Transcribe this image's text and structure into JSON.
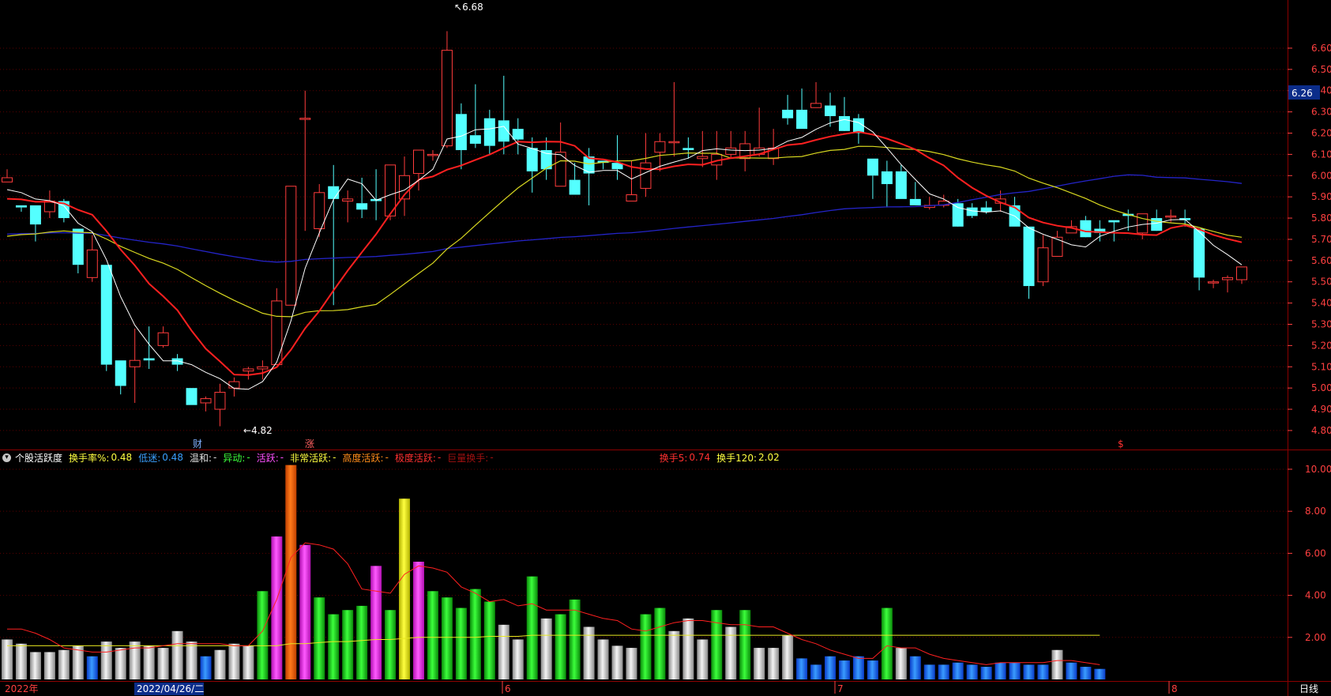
{
  "indicator_bar": {
    "name": "个股活跃度",
    "turnover_label": "换手率%:",
    "turnover_value": "0.48",
    "low_label": "低迷:",
    "low_value": "0.48",
    "mild_label": "温和:",
    "mild_value": "-",
    "abnormal_label": "异动:",
    "abnormal_value": "-",
    "active_label": "活跃:",
    "active_value": "-",
    "very_active_label": "非常活跃:",
    "very_active_value": "-",
    "high_active_label": "高度活跃:",
    "high_active_value": "-",
    "extreme_label": "极度活跃:",
    "extreme_value": "-",
    "huge_label": "巨量换手:",
    "huge_value": "-",
    "hs5_label": "换手5:",
    "hs5_value": "0.74",
    "hs120_label": "换手120:",
    "hs120_value": "2.02"
  },
  "bottom_axis": {
    "year": "2022年",
    "cursor_date": "2022/04/26/二",
    "months": [
      "6",
      "7",
      "8"
    ],
    "period": "日线"
  },
  "markers": {
    "high": "6.68",
    "low": "4.82",
    "cai": "财",
    "zhang": "涨",
    "dollar": "$"
  },
  "colors": {
    "up": "#ff3c3c",
    "down": "#54ffff",
    "ma5": "#ffffff",
    "ma10": "#ff2020",
    "ma20": "#d8d820",
    "ma60": "#2424c8",
    "current_price_box": "#0b2d8a"
  },
  "chart_data": [
    {
      "type": "candlestick",
      "y_ticks": [
        "6.60",
        "6.50",
        "6.40",
        "6.30",
        "6.20",
        "6.10",
        "6.00",
        "5.90",
        "5.80",
        "5.70",
        "5.60",
        "5.50",
        "5.40",
        "5.30",
        "5.20",
        "5.10",
        "5.00",
        "4.90",
        "4.80"
      ],
      "ylim": [
        4.77,
        6.73
      ],
      "current_price": "6.26",
      "ohlc": [
        [
          5.97,
          5.99,
          5.98,
          6.03
        ],
        [
          5.86,
          5.85,
          5.83,
          5.86
        ],
        [
          5.86,
          5.77,
          5.69,
          5.86
        ],
        [
          5.83,
          5.88,
          5.8,
          5.93
        ],
        [
          5.88,
          5.8,
          5.78,
          5.89
        ],
        [
          5.75,
          5.58,
          5.54,
          5.75
        ],
        [
          5.52,
          5.65,
          5.5,
          5.72
        ],
        [
          5.58,
          5.11,
          5.08,
          5.58
        ],
        [
          5.13,
          5.01,
          4.97,
          5.13
        ],
        [
          5.1,
          5.13,
          4.93,
          5.28
        ],
        [
          5.14,
          5.13,
          5.09,
          5.29
        ],
        [
          5.2,
          5.26,
          5.19,
          5.29
        ],
        [
          5.14,
          5.11,
          5.08,
          5.16
        ],
        [
          5.0,
          4.92,
          4.92,
          5.0
        ],
        [
          4.93,
          4.95,
          4.89,
          4.96
        ],
        [
          4.9,
          4.98,
          4.82,
          5.02
        ],
        [
          5.0,
          5.03,
          4.96,
          5.05
        ],
        [
          5.08,
          5.09,
          5.04,
          5.1
        ],
        [
          5.09,
          5.1,
          5.04,
          5.13
        ],
        [
          5.11,
          5.41,
          5.11,
          5.47
        ],
        [
          5.39,
          5.95,
          5.39,
          5.95
        ],
        [
          6.27,
          6.27,
          5.74,
          6.4
        ],
        [
          5.75,
          5.92,
          5.71,
          5.96
        ],
        [
          5.95,
          5.89,
          5.39,
          6.05
        ],
        [
          5.88,
          5.89,
          5.78,
          5.93
        ],
        [
          5.87,
          5.84,
          5.8,
          5.99
        ],
        [
          5.89,
          5.88,
          5.79,
          6.03
        ],
        [
          5.81,
          6.05,
          5.79,
          6.05
        ],
        [
          5.89,
          6.0,
          5.81,
          6.09
        ],
        [
          6.01,
          6.12,
          5.93,
          6.12
        ],
        [
          6.1,
          6.1,
          6.07,
          6.12
        ],
        [
          6.14,
          6.59,
          6.13,
          6.68
        ],
        [
          6.29,
          6.12,
          6.03,
          6.34
        ],
        [
          6.19,
          6.15,
          6.13,
          6.43
        ],
        [
          6.27,
          6.14,
          6.1,
          6.31
        ],
        [
          6.26,
          6.16,
          6.1,
          6.47
        ],
        [
          6.22,
          6.17,
          6.1,
          6.27
        ],
        [
          6.13,
          6.02,
          5.92,
          6.18
        ],
        [
          6.12,
          6.03,
          5.98,
          6.18
        ],
        [
          5.95,
          6.11,
          6.05,
          6.25
        ],
        [
          5.98,
          5.91,
          5.91,
          6.06
        ],
        [
          6.09,
          6.01,
          5.86,
          6.13
        ],
        [
          6.07,
          6.06,
          6.03,
          6.07
        ],
        [
          6.06,
          6.03,
          5.98,
          6.19
        ],
        [
          5.88,
          5.91,
          5.96,
          6.07
        ],
        [
          5.94,
          6.06,
          5.9,
          6.2
        ],
        [
          6.11,
          6.16,
          6.02,
          6.2
        ],
        [
          6.16,
          6.16,
          6.09,
          6.44
        ],
        [
          6.13,
          6.12,
          6.08,
          6.18
        ],
        [
          6.08,
          6.09,
          6.04,
          6.21
        ],
        [
          6.05,
          6.1,
          5.98,
          6.21
        ],
        [
          6.1,
          6.13,
          6.08,
          6.21
        ],
        [
          6.08,
          6.15,
          6.02,
          6.21
        ],
        [
          6.1,
          6.13,
          6.09,
          6.32
        ],
        [
          6.08,
          6.13,
          6.05,
          6.22
        ],
        [
          6.31,
          6.27,
          6.24,
          6.38
        ],
        [
          6.31,
          6.22,
          6.22,
          6.41
        ],
        [
          6.32,
          6.34,
          6.32,
          6.44
        ],
        [
          6.33,
          6.28,
          6.23,
          6.39
        ],
        [
          6.28,
          6.21,
          6.23,
          6.37
        ],
        [
          6.27,
          6.2,
          6.15,
          6.29
        ],
        [
          6.08,
          6.0,
          5.89,
          6.08
        ],
        [
          6.02,
          5.96,
          5.85,
          6.07
        ],
        [
          6.02,
          5.89,
          5.89,
          6.05
        ],
        [
          5.89,
          5.86,
          5.87,
          5.97
        ],
        [
          5.85,
          5.86,
          5.84,
          5.9
        ],
        [
          5.86,
          5.88,
          5.85,
          5.91
        ],
        [
          5.87,
          5.76,
          5.86,
          5.89
        ],
        [
          5.85,
          5.81,
          5.8,
          5.87
        ],
        [
          5.85,
          5.83,
          5.82,
          5.88
        ],
        [
          5.87,
          5.89,
          5.83,
          5.93
        ],
        [
          5.86,
          5.76,
          5.76,
          5.9
        ],
        [
          5.76,
          5.48,
          5.42,
          5.76
        ],
        [
          5.5,
          5.66,
          5.48,
          5.72
        ],
        [
          5.62,
          5.71,
          5.65,
          5.74
        ],
        [
          5.73,
          5.76,
          5.74,
          5.79
        ],
        [
          5.79,
          5.71,
          5.75,
          5.81
        ],
        [
          5.75,
          5.73,
          5.69,
          5.79
        ],
        [
          5.79,
          5.78,
          5.69,
          5.79
        ],
        [
          5.82,
          5.81,
          5.74,
          5.84
        ],
        [
          5.73,
          5.82,
          5.7,
          5.81
        ],
        [
          5.8,
          5.74,
          5.78,
          5.84
        ],
        [
          5.81,
          5.81,
          5.78,
          5.84
        ],
        [
          5.8,
          5.79,
          5.76,
          5.84
        ],
        [
          5.75,
          5.52,
          5.46,
          5.75
        ],
        [
          5.5,
          5.5,
          5.47,
          5.51
        ],
        [
          5.51,
          5.52,
          5.45,
          5.53
        ],
        [
          5.51,
          5.57,
          5.49,
          5.57
        ]
      ]
    },
    {
      "type": "bar",
      "y_ticks": [
        "10.00",
        "8.00",
        "6.00",
        "4.00",
        "2.00"
      ],
      "ylim": [
        0,
        10.6
      ],
      "turnover": [
        1.9,
        1.7,
        1.3,
        1.3,
        1.4,
        1.6,
        1.1,
        1.8,
        1.5,
        1.8,
        1.6,
        1.5,
        2.3,
        1.8,
        1.1,
        1.4,
        1.7,
        1.6,
        4.2,
        6.8,
        10.2,
        6.4,
        3.9,
        3.1,
        3.3,
        3.5,
        5.4,
        3.3,
        8.6,
        5.6,
        4.2,
        3.9,
        3.4,
        4.3,
        3.7,
        2.6,
        1.9,
        4.9,
        2.9,
        3.1,
        3.8,
        2.5,
        1.9,
        1.6,
        1.5,
        3.1,
        3.4,
        2.3,
        2.9,
        1.9,
        3.3,
        2.5,
        3.3,
        1.5,
        1.5,
        2.1,
        1.0,
        0.7,
        1.1,
        0.9,
        1.1,
        0.9,
        3.4,
        1.5,
        1.1,
        0.7,
        0.7,
        0.8,
        0.7,
        0.6,
        0.8,
        0.8,
        0.7,
        0.7,
        1.4,
        0.8,
        0.6,
        0.5
      ],
      "hs5": [
        2.4,
        2.4,
        2.2,
        1.9,
        1.5,
        1.4,
        1.3,
        1.3,
        1.4,
        1.5,
        1.5,
        1.6,
        1.7,
        1.7,
        1.7,
        1.7,
        1.6,
        1.6,
        2.3,
        3.8,
        5.8,
        6.5,
        6.4,
        6.2,
        5.5,
        4.3,
        4.2,
        4.1,
        5.0,
        5.4,
        5.3,
        5.1,
        4.4,
        4.1,
        3.7,
        3.8,
        3.5,
        3.6,
        3.3,
        3.3,
        3.3,
        3.1,
        2.9,
        2.8,
        2.4,
        2.3,
        2.5,
        2.7,
        2.8,
        2.8,
        2.7,
        2.6,
        2.6,
        2.5,
        2.5,
        2.2,
        1.9,
        1.7,
        1.4,
        1.2,
        1.0,
        1.0,
        1.6,
        1.5,
        1.5,
        1.2,
        1.0,
        0.9,
        0.8,
        0.7,
        0.8,
        0.8,
        0.8,
        0.8,
        0.9,
        0.9,
        0.8,
        0.7
      ],
      "hs120": [
        1.6,
        1.6,
        1.6,
        1.6,
        1.6,
        1.6,
        1.6,
        1.6,
        1.6,
        1.6,
        1.6,
        1.6,
        1.6,
        1.6,
        1.6,
        1.6,
        1.6,
        1.6,
        1.6,
        1.6,
        1.7,
        1.7,
        1.75,
        1.8,
        1.8,
        1.85,
        1.9,
        1.9,
        1.95,
        2.0,
        2.0,
        2.0,
        2.0,
        2.0,
        2.05,
        2.05,
        2.05,
        2.1,
        2.1,
        2.1,
        2.1,
        2.1,
        2.1,
        2.1,
        2.1,
        2.1,
        2.1,
        2.1,
        2.1,
        2.1,
        2.1,
        2.1,
        2.1,
        2.1,
        2.1,
        2.1,
        2.1,
        2.1,
        2.1,
        2.1,
        2.1,
        2.1,
        2.1,
        2.1,
        2.1,
        2.1,
        2.1,
        2.1,
        2.1,
        2.1,
        2.1,
        2.1,
        2.1,
        2.1,
        2.1,
        2.1,
        2.1,
        2.1
      ]
    }
  ]
}
